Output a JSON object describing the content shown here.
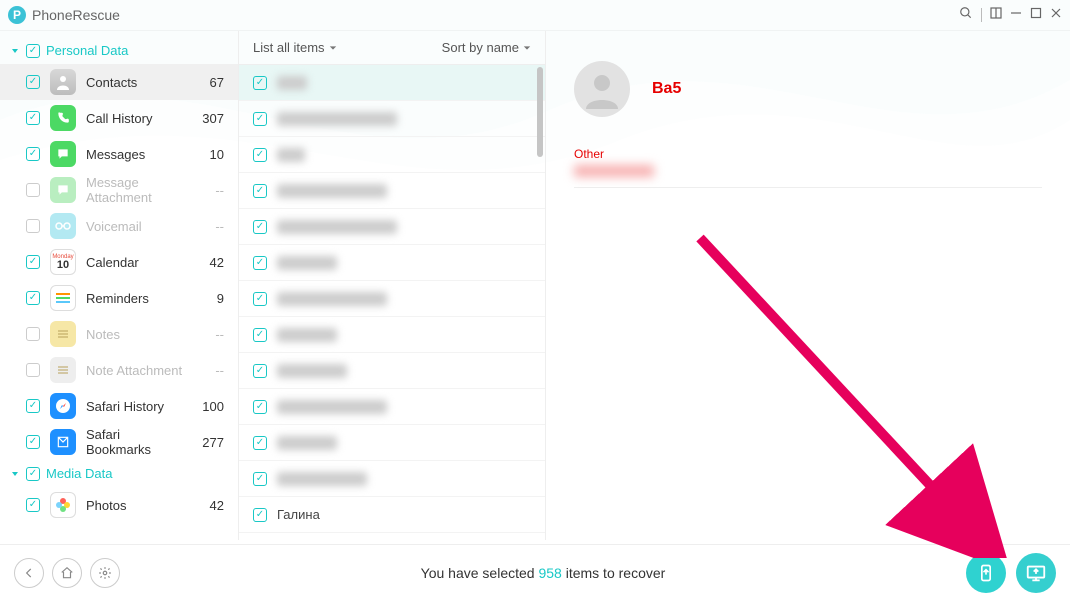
{
  "app_title": "PhoneRescue",
  "sections": [
    {
      "label": "Personal Data",
      "expanded": true
    },
    {
      "label": "Media Data",
      "expanded": true
    }
  ],
  "categories_personal": [
    {
      "key": "contacts",
      "label": "Contacts",
      "count": "67",
      "checked": true,
      "enabled": true,
      "selected": true,
      "icon": "ic-contacts"
    },
    {
      "key": "call",
      "label": "Call History",
      "count": "307",
      "checked": true,
      "enabled": true,
      "selected": false,
      "icon": "ic-call"
    },
    {
      "key": "msg",
      "label": "Messages",
      "count": "10",
      "checked": true,
      "enabled": true,
      "selected": false,
      "icon": "ic-msg"
    },
    {
      "key": "msgatt",
      "label": "Message Attachment",
      "count": "--",
      "checked": false,
      "enabled": false,
      "selected": false,
      "icon": "ic-msgatt"
    },
    {
      "key": "voice",
      "label": "Voicemail",
      "count": "--",
      "checked": false,
      "enabled": false,
      "selected": false,
      "icon": "ic-voice"
    },
    {
      "key": "cal",
      "label": "Calendar",
      "count": "42",
      "checked": true,
      "enabled": true,
      "selected": false,
      "icon": "ic-cal"
    },
    {
      "key": "rem",
      "label": "Reminders",
      "count": "9",
      "checked": true,
      "enabled": true,
      "selected": false,
      "icon": "ic-rem"
    },
    {
      "key": "notes",
      "label": "Notes",
      "count": "--",
      "checked": false,
      "enabled": false,
      "selected": false,
      "icon": "ic-notes"
    },
    {
      "key": "noteatt",
      "label": "Note Attachment",
      "count": "--",
      "checked": false,
      "enabled": false,
      "selected": false,
      "icon": "ic-noteatt"
    },
    {
      "key": "safari",
      "label": "Safari History",
      "count": "100",
      "checked": true,
      "enabled": true,
      "selected": false,
      "icon": "ic-safari"
    },
    {
      "key": "bookmark",
      "label": "Safari Bookmarks",
      "count": "277",
      "checked": true,
      "enabled": true,
      "selected": false,
      "icon": "ic-bookmark"
    }
  ],
  "categories_media": [
    {
      "key": "photos",
      "label": "Photos",
      "count": "42",
      "checked": true,
      "enabled": true,
      "selected": false,
      "icon": "ic-photos"
    }
  ],
  "list_header": {
    "filter": "List all items",
    "sort": "Sort by name"
  },
  "list_items": [
    {
      "blurWidth": 30,
      "selected": true
    },
    {
      "blurWidth": 120
    },
    {
      "blurWidth": 28
    },
    {
      "blurWidth": 110
    },
    {
      "blurWidth": 120
    },
    {
      "blurWidth": 60
    },
    {
      "blurWidth": 110
    },
    {
      "blurWidth": 60
    },
    {
      "blurWidth": 70
    },
    {
      "blurWidth": 110
    },
    {
      "blurWidth": 60
    },
    {
      "blurWidth": 90
    },
    {
      "text": "Галина"
    }
  ],
  "detail": {
    "name": "Ba5",
    "field_label": "Other"
  },
  "footer": {
    "prefix": "You have selected ",
    "count": "958",
    "suffix": " items to recover"
  },
  "calendar_icon": {
    "top": "Monday",
    "day": "10"
  }
}
